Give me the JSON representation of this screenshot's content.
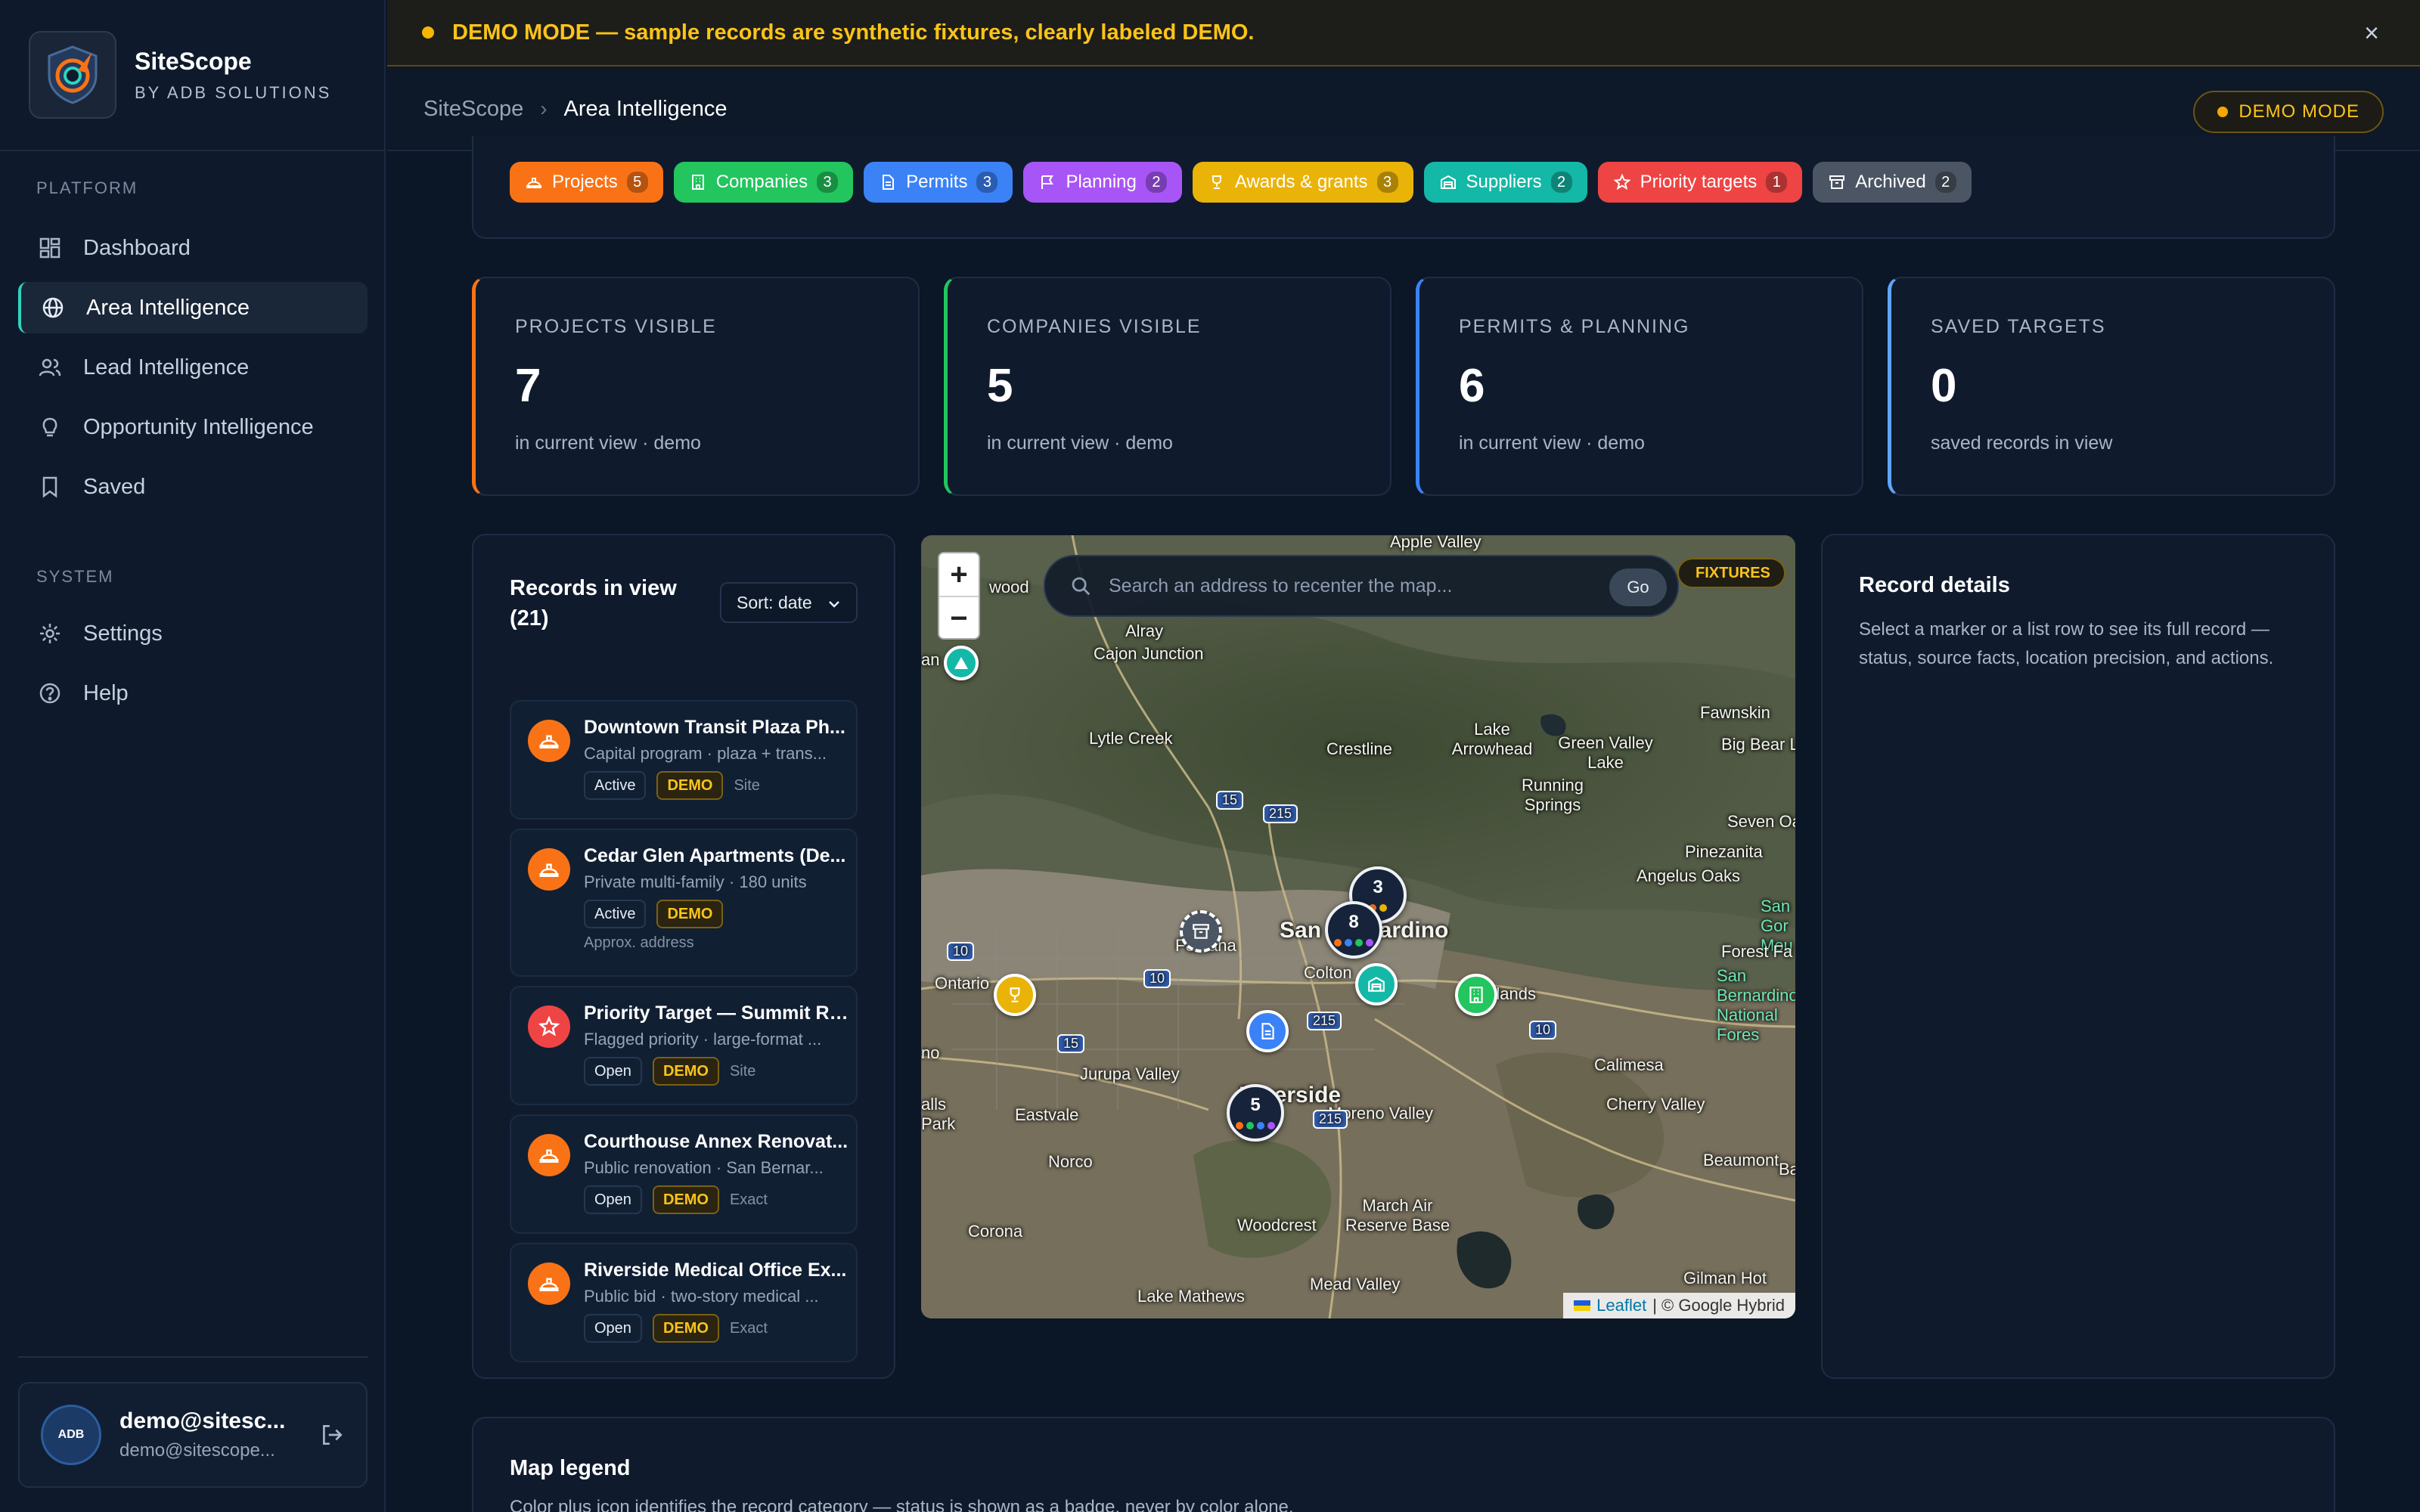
{
  "brand": {
    "name": "SiteScope",
    "subtitle": "BY ADB SOLUTIONS"
  },
  "sidebar": {
    "platform_heading": "PLATFORM",
    "system_heading": "SYSTEM",
    "items": [
      {
        "label": "Dashboard",
        "icon": "dashboard-icon"
      },
      {
        "label": "Area Intelligence",
        "icon": "globe-icon",
        "active": true
      },
      {
        "label": "Lead Intelligence",
        "icon": "users-icon"
      },
      {
        "label": "Opportunity Intelligence",
        "icon": "lightbulb-icon"
      },
      {
        "label": "Saved",
        "icon": "bookmark-icon"
      }
    ],
    "system_items": [
      {
        "label": "Settings",
        "icon": "gear-icon"
      },
      {
        "label": "Help",
        "icon": "help-icon"
      }
    ]
  },
  "user": {
    "name": "demo@sitesc...",
    "email": "demo@sitescope...",
    "avatar_text": "ADB"
  },
  "banner": {
    "text": "DEMO MODE — sample records are synthetic fixtures, clearly labeled DEMO.",
    "color": "#fcc419"
  },
  "header": {
    "breadcrumb_root": "SiteScope",
    "breadcrumb_current": "Area Intelligence",
    "mode_badge": "DEMO MODE"
  },
  "filters": [
    {
      "label": "Projects",
      "count": "5",
      "color": "#f97316",
      "icon": "hardhat-icon"
    },
    {
      "label": "Companies",
      "count": "3",
      "color": "#22c55e",
      "icon": "building-icon"
    },
    {
      "label": "Permits",
      "count": "3",
      "color": "#3b82f6",
      "icon": "document-icon"
    },
    {
      "label": "Planning",
      "count": "2",
      "color": "#a855f7",
      "icon": "flag-icon"
    },
    {
      "label": "Awards & grants",
      "count": "3",
      "color": "#eab308",
      "icon": "trophy-icon"
    },
    {
      "label": "Suppliers",
      "count": "2",
      "color": "#14b8a6",
      "icon": "warehouse-icon"
    },
    {
      "label": "Priority targets",
      "count": "1",
      "color": "#ef4444",
      "icon": "star-icon"
    },
    {
      "label": "Archived",
      "count": "2",
      "color": "#4b5563",
      "icon": "archive-icon"
    }
  ],
  "stats": [
    {
      "label": "PROJECTS VISIBLE",
      "value": "7",
      "sub": "in current view · demo",
      "color": "#f97316"
    },
    {
      "label": "COMPANIES VISIBLE",
      "value": "5",
      "sub": "in current view · demo",
      "color": "#22c55e"
    },
    {
      "label": "PERMITS & PLANNING",
      "value": "6",
      "sub": "in current view · demo",
      "color": "#3b82f6"
    },
    {
      "label": "SAVED TARGETS",
      "value": "0",
      "sub": "saved records in view",
      "color": "#60a5fa"
    }
  ],
  "records": {
    "title": "Records in view (21)",
    "sort_label": "Sort: date",
    "items": [
      {
        "title": "Downtown Transit Plaza Ph...",
        "sub": "Capital program · plaza + trans...",
        "status": "Active",
        "demo": "DEMO",
        "precision": "Site",
        "color": "#f97316",
        "icon": "hardhat-icon"
      },
      {
        "title": "Cedar Glen Apartments (De...",
        "sub": "Private multi-family · 180 units",
        "status": "Active",
        "demo": "DEMO",
        "precision": "Approx. address",
        "color": "#f97316",
        "icon": "hardhat-icon"
      },
      {
        "title": "Priority Target — Summit Ri...",
        "sub": "Flagged priority · large-format ...",
        "status": "Open",
        "demo": "DEMO",
        "precision": "Site",
        "color": "#ef4444",
        "icon": "star-icon"
      },
      {
        "title": "Courthouse Annex Renovat...",
        "sub": "Public renovation · San Bernar...",
        "status": "Open",
        "demo": "DEMO",
        "precision": "Exact",
        "color": "#f97316",
        "icon": "hardhat-icon"
      },
      {
        "title": "Riverside Medical Office Ex...",
        "sub": "Public bid · two-story medical ...",
        "status": "Open",
        "demo": "DEMO",
        "precision": "Exact",
        "color": "#f97316",
        "icon": "hardhat-icon"
      }
    ]
  },
  "map": {
    "search_placeholder": "Search an address to recenter the map...",
    "go_label": "Go",
    "fixtures_label": "FIXTURES",
    "zoom_in": "+",
    "zoom_out": "−",
    "attribution_link": "Leaflet",
    "attribution_text": "| © Google Hybrid",
    "places": [
      "Apple Valley",
      "wood",
      "Alray",
      "Cajon Junction",
      "Lytle Creek",
      "Crestline",
      "Lake Arrowhead",
      "Green Valley Lake",
      "Fawnskin",
      "Big Bear L",
      "Running Springs",
      "Seven Oa",
      "Pinezanita",
      "Angelus Oaks",
      "San Gor Mou",
      "Forest Fa",
      "San Bernardino National Fores",
      "San Bernardino",
      "Fontana",
      "Colton",
      "Redlands",
      "Ontario",
      "Calimesa",
      "Riverside",
      "Jurupa Valley",
      "Eastvale",
      "Norco",
      "Cherry Valley",
      "Beaumont",
      "Moreno Valley",
      "March Air Reserve Base",
      "Woodcrest",
      "Corona",
      "Mead Valley",
      "Lake Mathews",
      "Gilman Hot",
      "no",
      "an",
      "alls Park",
      "Ba"
    ],
    "highways": [
      "15",
      "215",
      "10",
      "10",
      "10",
      "215",
      "15",
      "215",
      "10"
    ],
    "clusters": [
      "3",
      "8",
      "5"
    ]
  },
  "details": {
    "title": "Record details",
    "text": "Select a marker or a list row to see its full record — status, source facts, location precision, and actions."
  },
  "legend": {
    "title": "Map legend",
    "text": "Color plus icon identifies the record category — status is shown as a badge, never by color alone."
  }
}
